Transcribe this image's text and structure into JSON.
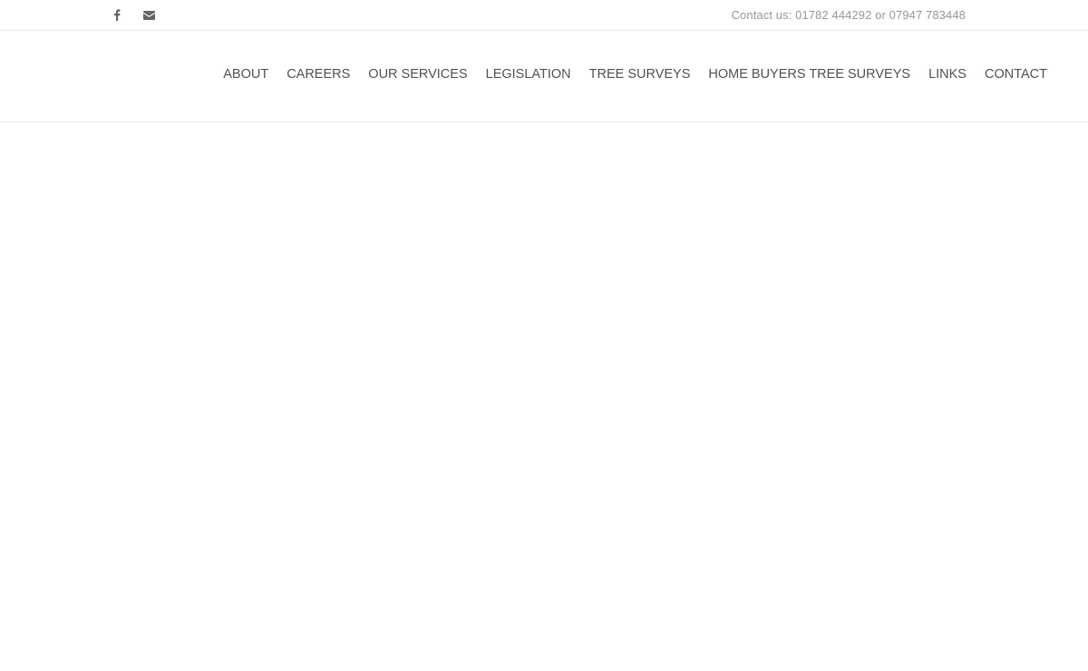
{
  "topbar": {
    "social_icons": [
      "facebook-icon",
      "envelope-icon"
    ],
    "contact_text": "Contact us: 01782 444292 or 07947 783448"
  },
  "nav": {
    "items": [
      {
        "label": "ABOUT"
      },
      {
        "label": "CAREERS"
      },
      {
        "label": "OUR SERVICES"
      },
      {
        "label": "LEGISLATION"
      },
      {
        "label": "TREE SURVEYS"
      },
      {
        "label": "HOME BUYERS TREE SURVEYS"
      },
      {
        "label": "LINKS"
      },
      {
        "label": "CONTACT"
      }
    ]
  },
  "colors": {
    "text": "#555555",
    "muted_text": "#9a9a9a",
    "background": "#ffffff",
    "border": "#eaeaea"
  }
}
